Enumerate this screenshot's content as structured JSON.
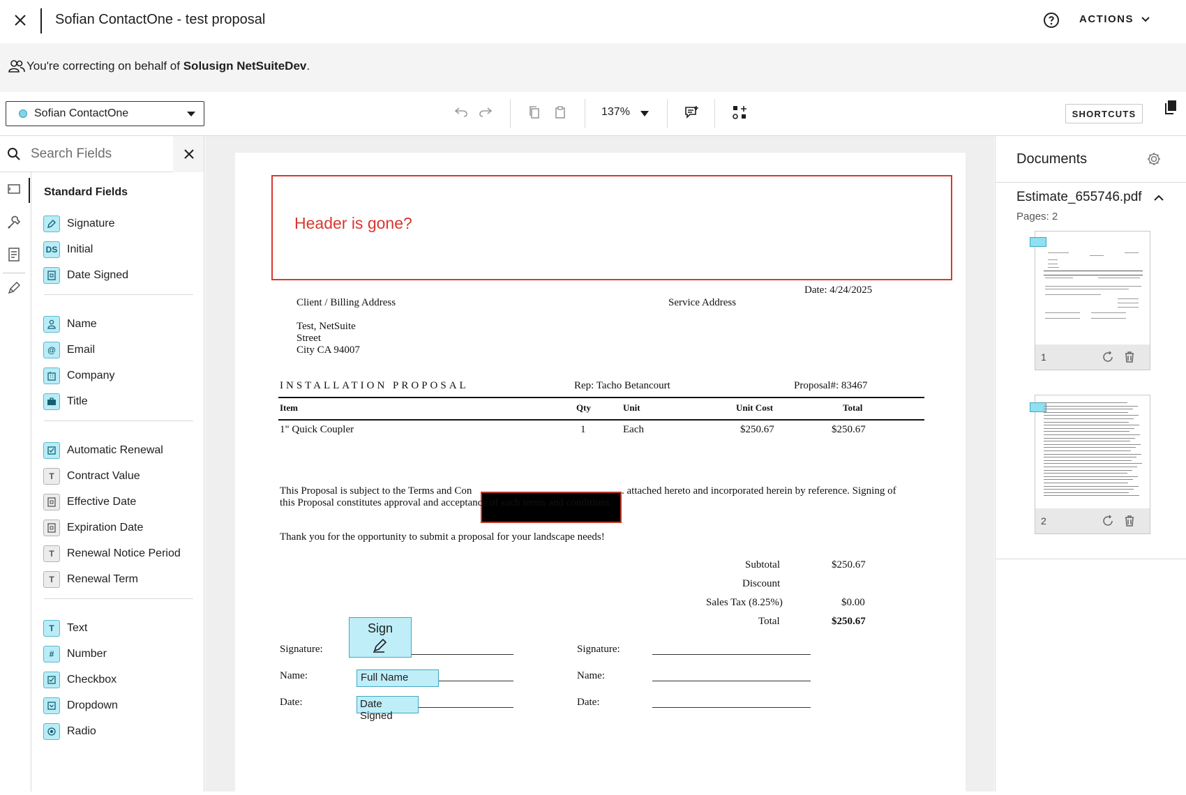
{
  "header": {
    "title": "Sofian ContactOne - test proposal",
    "actions_label": "ACTIONS"
  },
  "banner": {
    "prefix": "You're correcting on behalf of ",
    "account": "Solusign NetSuiteDev",
    "suffix": "."
  },
  "toolbar": {
    "recipient": "Sofian ContactOne",
    "zoom": "137%",
    "shortcuts_label": "SHORTCUTS"
  },
  "left_panel": {
    "search_placeholder": "Search Fields",
    "section_title": "Standard Fields",
    "groups": [
      [
        {
          "label": "Signature",
          "icon": "pen-icon"
        },
        {
          "label": "Initial",
          "icon": "DS"
        },
        {
          "label": "Date Signed",
          "icon": "date-icon"
        }
      ],
      [
        {
          "label": "Name",
          "icon": "person-icon"
        },
        {
          "label": "Email",
          "icon": "@"
        },
        {
          "label": "Company",
          "icon": "building-icon"
        },
        {
          "label": "Title",
          "icon": "briefcase-icon"
        }
      ],
      [
        {
          "label": "Automatic Renewal",
          "icon": "checkbox-icon"
        },
        {
          "label": "Contract Value",
          "icon": "T"
        },
        {
          "label": "Effective Date",
          "icon": "date-icon"
        },
        {
          "label": "Expiration Date",
          "icon": "date-icon"
        },
        {
          "label": "Renewal Notice Period",
          "icon": "T"
        },
        {
          "label": "Renewal Term",
          "icon": "T"
        }
      ],
      [
        {
          "label": "Text",
          "icon": "T"
        },
        {
          "label": "Number",
          "icon": "#"
        },
        {
          "label": "Checkbox",
          "icon": "checkbox-icon"
        },
        {
          "label": "Dropdown",
          "icon": "dropdown-icon"
        },
        {
          "label": "Radio",
          "icon": "radio-icon"
        }
      ]
    ]
  },
  "document": {
    "header_note": "Header is gone?",
    "date": "Date: 4/24/2025",
    "client_label": "Client / Billing Address",
    "service_label": "Service Address",
    "address": [
      "Test, NetSuite",
      "Street",
      "City CA 94007"
    ],
    "proposal_title": "INSTALLATION PROPOSAL",
    "rep": "Rep: Tacho Betancourt",
    "proposal_no": "Proposal#: 83467",
    "columns": [
      "Item",
      "Qty",
      "Unit",
      "Unit Cost",
      "Total"
    ],
    "rows": [
      [
        "1\" Quick Coupler",
        "1",
        "Each",
        "$250.67",
        "$250.67"
      ]
    ],
    "terms_a": "This Proposal is subject to the Terms and Con",
    "terms_b": ". attached hereto and incorporated herein by reference. Signing of",
    "terms_c": "this Proposal constitutes approval and acceptance of such terms and conditions",
    "thanks": "Thank you for the opportunity to submit a proposal for your landscape needs!",
    "totals": [
      {
        "label": "Subtotal",
        "value": "$250.67"
      },
      {
        "label": "Discount",
        "value": ""
      },
      {
        "label": "Sales Tax (8.25%)",
        "value": "$0.00"
      },
      {
        "label": "Total",
        "value": "$250.67"
      }
    ],
    "sig_labels": {
      "signature": "Signature:",
      "name": "Name:",
      "date": "Date:"
    },
    "tags": {
      "sign": "Sign",
      "full_name": "Full Name",
      "date_signed": "Date Signed"
    }
  },
  "right_panel": {
    "title": "Documents",
    "doc_name": "Estimate_655746.pdf",
    "pages_label": "Pages: 2",
    "thumbnails": [
      {
        "page": "1"
      },
      {
        "page": "2"
      }
    ]
  },
  "colors": {
    "accent_field": "#b8ecf7",
    "note_red": "#d9362f"
  }
}
